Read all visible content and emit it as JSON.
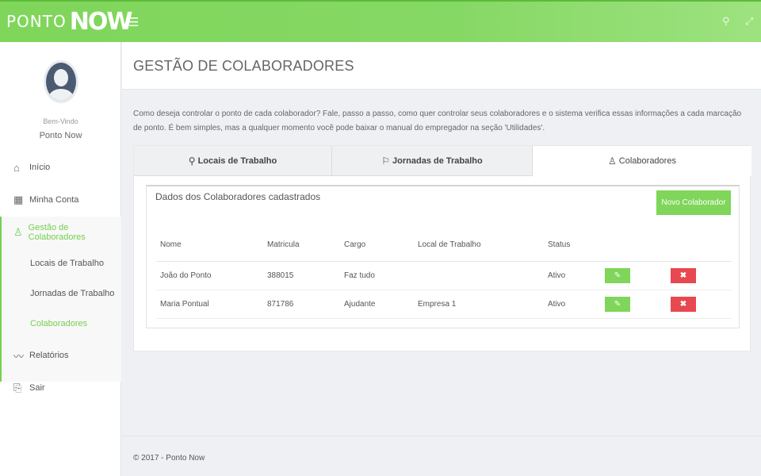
{
  "brand": {
    "ponto": "PONTO",
    "now": "NOW"
  },
  "topbar": {
    "menu_icon": "☰",
    "search_icon": "⚲",
    "expand_icon": "⤢"
  },
  "sidebar": {
    "welcome": "Bem-Vindo",
    "username": "Ponto Now",
    "items": [
      {
        "label": "Início",
        "icon": "⌂"
      },
      {
        "label": "Minha Conta",
        "icon": "▦"
      },
      {
        "label": "Gestão de Colaboradores",
        "icon": "♙"
      },
      {
        "label": "Relatórios",
        "icon": "〰"
      },
      {
        "label": "Sair",
        "icon": "⎘"
      }
    ],
    "subitems": [
      {
        "label": "Locais de Trabalho"
      },
      {
        "label": "Jornadas de Trabalho"
      },
      {
        "label": "Colaboradores"
      }
    ]
  },
  "page": {
    "title": "GESTÃO DE COLABORADORES",
    "intro": "Como deseja controlar o ponto de cada colaborador? Fale, passo a passo, como quer controlar seus colaboradores e o sistema verifica essas informações a cada marcação de ponto. É bem simples, mas a qualquer momento você pode baixar o manual do empregador na seção 'Utilidades'."
  },
  "tabs": [
    {
      "label": "Locais de Trabalho",
      "icon": "⚲"
    },
    {
      "label": "Jornadas de Trabalho",
      "icon": "⚐"
    },
    {
      "label": "Colaboradores",
      "icon": "♙"
    }
  ],
  "card": {
    "title": "Dados dos Colaboradores cadastrados",
    "new_button": "Novo Colaborador",
    "columns": [
      "Nome",
      "Matricula",
      "Cargo",
      "Local de Trabalho",
      "Status"
    ],
    "rows": [
      {
        "nome": "João do Ponto",
        "matricula": "388015",
        "cargo": "Faz tudo",
        "local": "",
        "status": "Ativo"
      },
      {
        "nome": "Maria Pontual",
        "matricula": "871786",
        "cargo": "Ajudante",
        "local": "Empresa 1",
        "status": "Ativo"
      }
    ],
    "edit_icon": "✎",
    "delete_icon": "✖"
  },
  "footer": {
    "text": "© 2017 - Ponto Now"
  },
  "colors": {
    "accent": "#7fd65a",
    "danger": "#e8484f"
  }
}
